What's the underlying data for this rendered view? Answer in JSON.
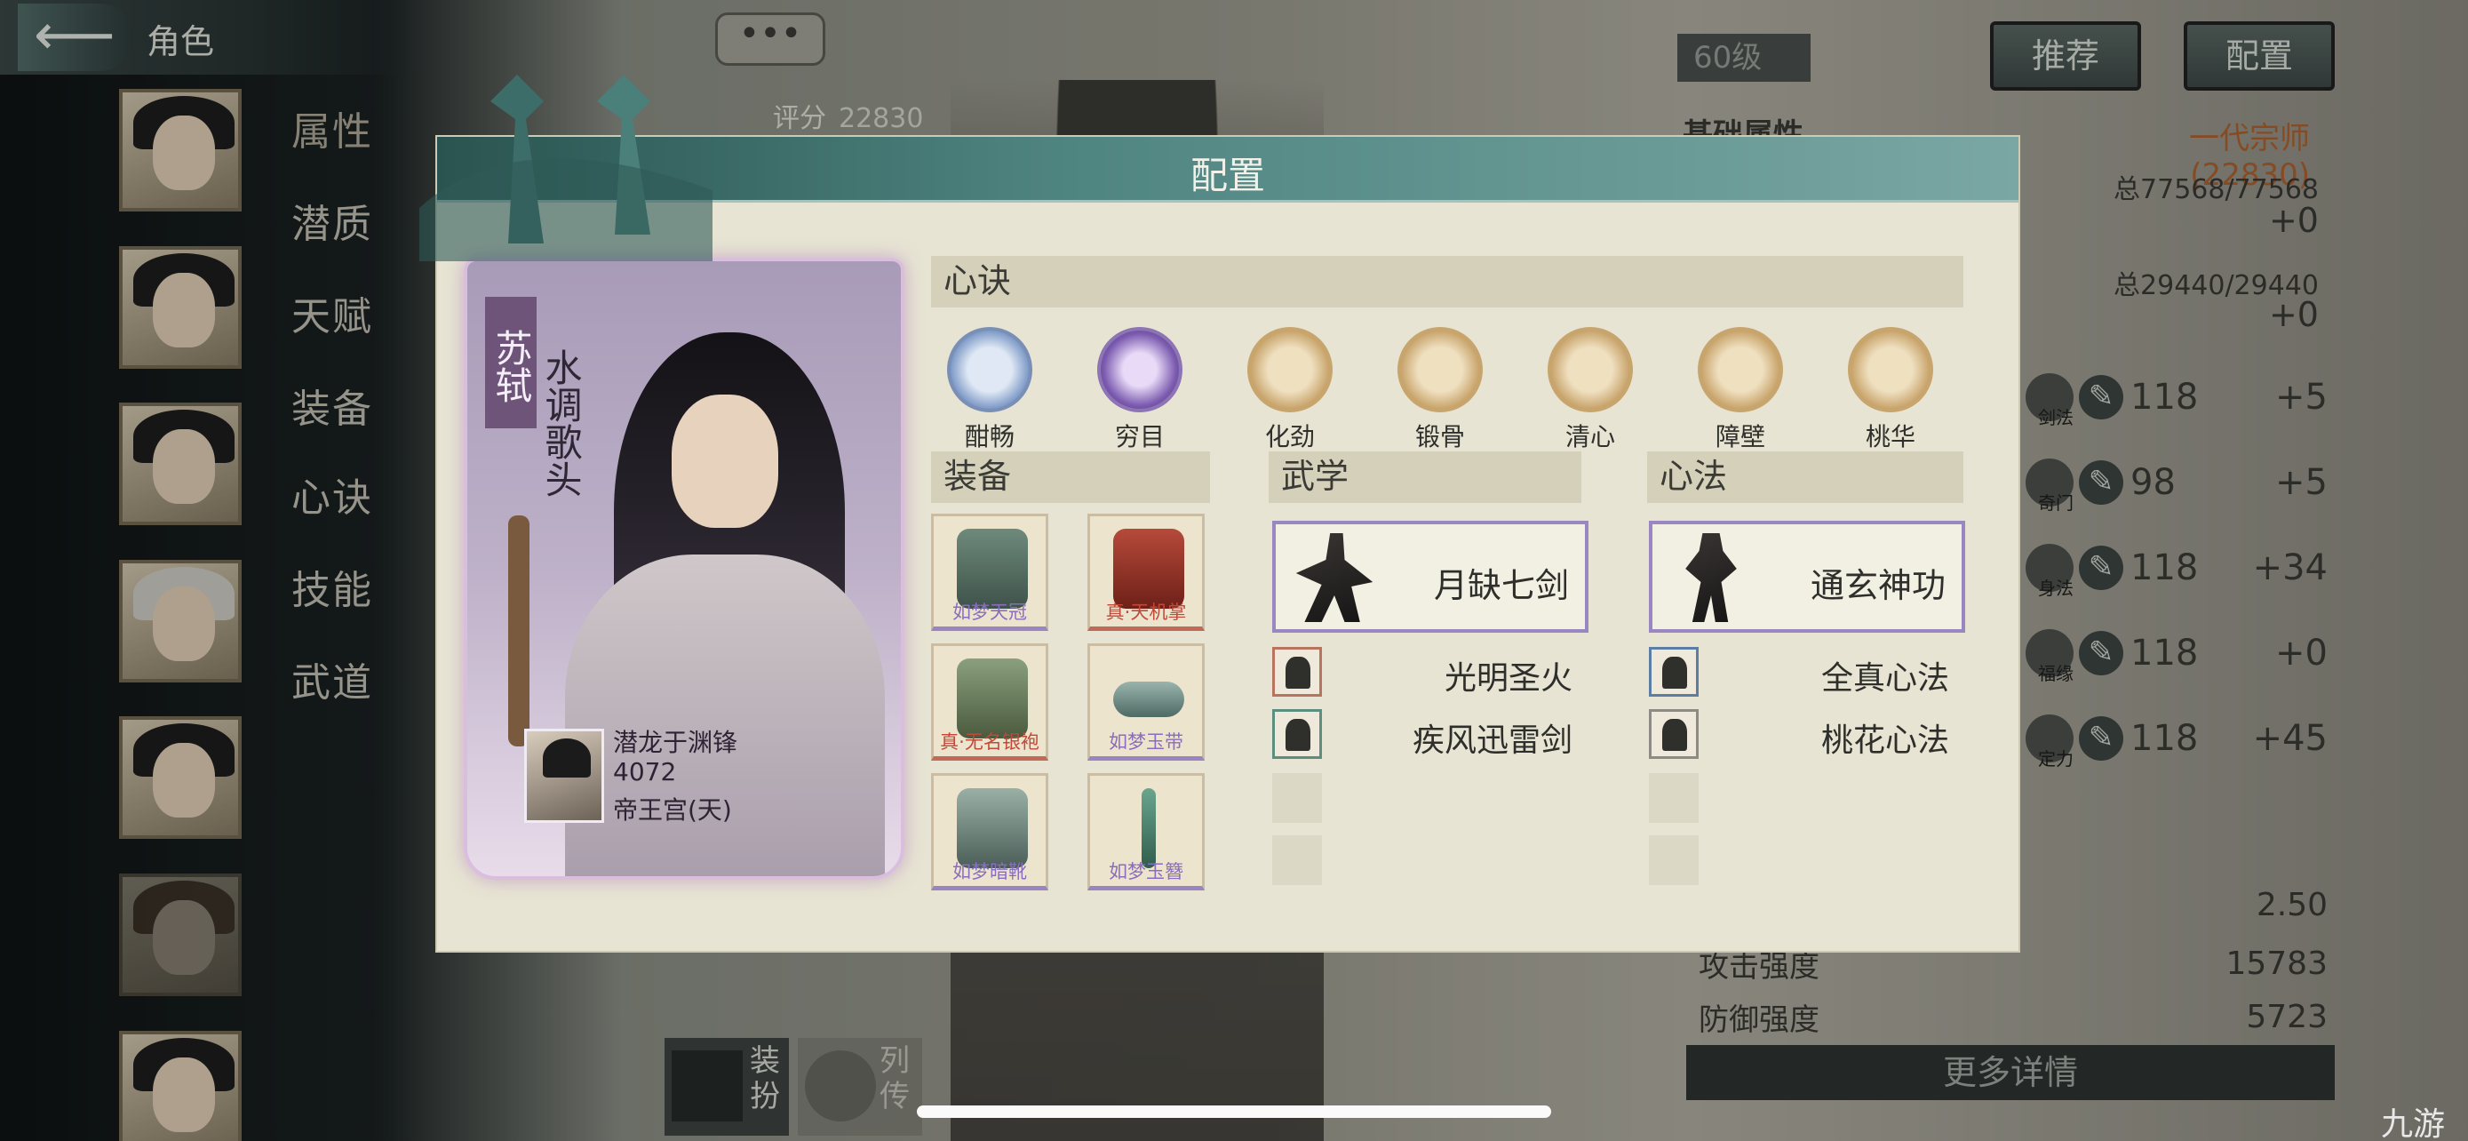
{
  "header": {
    "back_title": "角色",
    "score_label": "评分",
    "score_value": "22830",
    "bubble": "•••"
  },
  "sidebar": {
    "tabs": [
      "属性",
      "潜质",
      "天赋",
      "装备",
      "心诀",
      "技能",
      "武道"
    ],
    "portraits": 7
  },
  "right_panel": {
    "level": "60级",
    "btn_recommend": "推荐",
    "btn_config": "配置",
    "base_attr": "基础属性",
    "rank": "一代宗师(22830)",
    "hp": "总77568/77568",
    "hp_plus": "+0",
    "mp": "总29440/29440",
    "mp_plus": "+0",
    "skills": [
      {
        "name": "剑法",
        "value": "118",
        "plus": "+5"
      },
      {
        "name": "奇门",
        "value": "98",
        "plus": "+5"
      },
      {
        "name": "身法",
        "value": "118",
        "plus": "+34"
      },
      {
        "name": "福缘",
        "value": "118",
        "plus": "+0"
      },
      {
        "name": "定力",
        "value": "118",
        "plus": "+45"
      }
    ],
    "misc_value": "2.50",
    "attack_label": "攻击强度",
    "attack_value": "15783",
    "defense_label": "防御强度",
    "defense_value": "5723",
    "details_btn": "更多详情"
  },
  "bottom": {
    "dress": "装扮",
    "biography": "列传"
  },
  "watermark": "九游",
  "modal": {
    "title": "配置",
    "card": {
      "name": "苏轼",
      "title": "水调歌头",
      "owner_name": "潜龙于渊锋",
      "owner_id": "4072",
      "owner_server": "帝王宫(天)"
    },
    "xinjue_header": "心诀",
    "xinjue": [
      {
        "label": "酣畅",
        "color": "blue"
      },
      {
        "label": "穷目",
        "color": "purple"
      },
      {
        "label": "化劲",
        "color": "gold"
      },
      {
        "label": "锻骨",
        "color": "gold"
      },
      {
        "label": "清心",
        "color": "gold"
      },
      {
        "label": "障壁",
        "color": "gold"
      },
      {
        "label": "桃华",
        "color": "gold"
      }
    ],
    "equip_header": "装备",
    "equipment": [
      {
        "name": "如梦天冠",
        "rarity": "purple"
      },
      {
        "name": "真·天机掌",
        "rarity": "red"
      },
      {
        "name": "真·无名银袍",
        "rarity": "red"
      },
      {
        "name": "如梦玉带",
        "rarity": "purple"
      },
      {
        "name": "如梦暗靴",
        "rarity": "purple"
      },
      {
        "name": "如梦玉簪",
        "rarity": "purple"
      }
    ],
    "wuxue_header": "武学",
    "wuxue_main": "月缺七剑",
    "wuxue_sub": [
      "光明圣火",
      "疾风迅雷剑"
    ],
    "xinfa_header": "心法",
    "xinfa_main": "通玄神功",
    "xinfa_sub": [
      "全真心法",
      "桃花心法"
    ]
  }
}
